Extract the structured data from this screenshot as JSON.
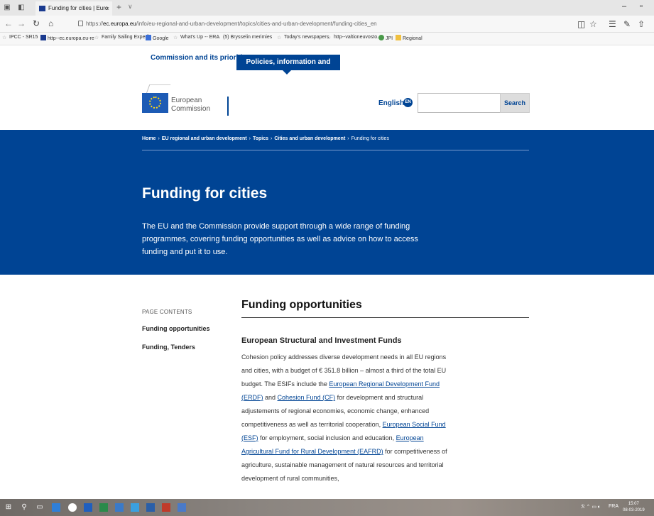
{
  "browser": {
    "tab_title": "Funding for cities | Euro",
    "tab_close": "×",
    "new_tab": "+",
    "tab_menu": "∨",
    "url_scheme": "https://",
    "url_host": "ec.europa.eu",
    "url_path": "/info/eu-regional-and-urban-development/topics/cities-and-urban-development/funding-cities_en",
    "minimize": "–",
    "restore": "▫",
    "favorites": [
      "IPCC - SR15",
      "http--ec.europa.eu-re",
      "Family Sailing Expedi",
      "Google",
      "What's Up -- ERA",
      "(5) Brysselin merimies",
      "Today's newspapers.",
      "http--valtioneuvosto.",
      "JPI",
      "Regional"
    ]
  },
  "site": {
    "nav_commission": "Commission and its priorities",
    "nav_policies": "Policies, information and services",
    "logo_line1": "European",
    "logo_line2": "Commission",
    "language": "English",
    "language_code": "EN",
    "search_placeholder": "",
    "search_button": "Search"
  },
  "breadcrumb": [
    "Home",
    "EU regional and urban development",
    "Topics",
    "Cities and urban development",
    "Funding for cities"
  ],
  "hero": {
    "title": "Funding for cities",
    "description": "The EU and the Commission provide support through a wide range of funding programmes, covering funding opportunities as well as advice on how to access funding and put it to use."
  },
  "sidebar": {
    "label": "PAGE CONTENTS",
    "links": [
      "Funding opportunities",
      "Funding, Tenders"
    ]
  },
  "main": {
    "heading": "Funding opportunities",
    "subheading": "European Structural and Investment Funds",
    "text_1": "Cohesion policy addresses diverse development needs in all EU regions and cities, with a budget of € 351.8 billion – almost a third of the total EU budget. The ESIFs include the ",
    "link_erdf": "European Regional Development Fund (ERDF)",
    "text_2": " and ",
    "link_cf": "Cohesion Fund (CF)",
    "text_3": " for development and structural adjustements of regional economies, economic change, enhanced competitiveness as well as territorial cooperation, ",
    "link_esf": "European Social Fund (ESF)",
    "text_4": " for employment, social inclusion and education, ",
    "link_eafrd": "European Agricultural Fund for Rural Development (EAFRD)",
    "text_5": " for competitiveness of agriculture,  sustainable management of natural resources and territorial development of rural communities,"
  },
  "taskbar": {
    "lang": "FRA",
    "time": "15:07",
    "date": "08-03-2019"
  },
  "colors": {
    "ec_blue": "#004494",
    "link": "#004494"
  }
}
